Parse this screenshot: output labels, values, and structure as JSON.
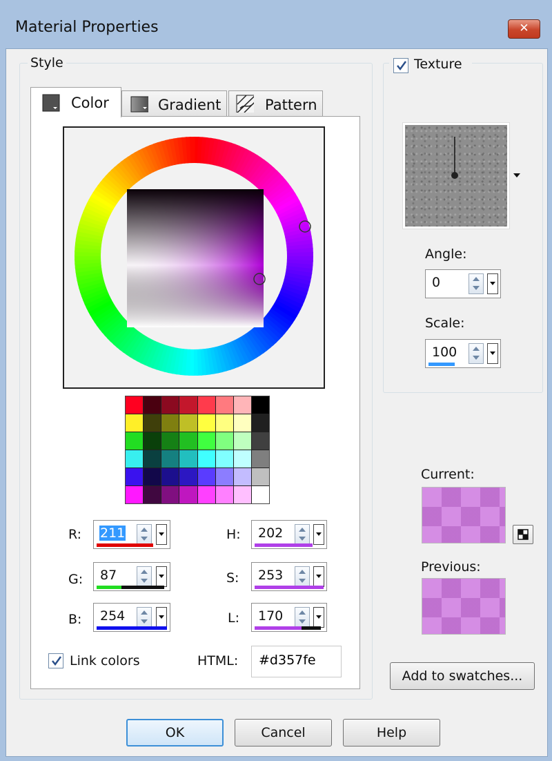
{
  "window": {
    "title": "Material Properties",
    "close_glyph": "✕"
  },
  "style": {
    "legend": "Style",
    "tabs": [
      {
        "label": "Color",
        "icon": "color-swatch-icon"
      },
      {
        "label": "Gradient",
        "icon": "gradient-icon"
      },
      {
        "label": "Pattern",
        "icon": "pattern-icon"
      }
    ],
    "selected_color": "#d357fe",
    "swatch_rows": [
      [
        "#ff0020",
        "#4a0010",
        "#8b0a20",
        "#c3172c",
        "#ff3b4c",
        "#ff7a7f",
        "#ffb5b8",
        "#000000"
      ],
      [
        "#ffef28",
        "#3f3f0a",
        "#7f7f10",
        "#bfbf26",
        "#ffff40",
        "#ffff80",
        "#ffffbf",
        "#202020"
      ],
      [
        "#22dd22",
        "#0a400a",
        "#158015",
        "#22bf22",
        "#40ff40",
        "#80ff80",
        "#bfffbf",
        "#404040"
      ],
      [
        "#38efef",
        "#0a4040",
        "#158080",
        "#22bfbf",
        "#40ffff",
        "#80ffff",
        "#bfffff",
        "#7f7f7f"
      ],
      [
        "#3a12ee",
        "#12084a",
        "#1c0f8d",
        "#2c17c2",
        "#5a3cff",
        "#8c7dff",
        "#c3bcff",
        "#bfbfbf"
      ],
      [
        "#ff18ff",
        "#400840",
        "#800f80",
        "#bf17bf",
        "#ff40ff",
        "#ff80ff",
        "#ffbfff",
        "#ffffff"
      ]
    ],
    "fields": {
      "r": {
        "label": "R:",
        "value": "211",
        "bar_color": "#e00000"
      },
      "g": {
        "label": "G:",
        "value": "87",
        "bar_color": "#22dd22"
      },
      "b": {
        "label": "B:",
        "value": "254",
        "bar_color": "#1010ee"
      },
      "h": {
        "label": "H:",
        "value": "202",
        "bar_color": "#b040e8"
      },
      "s": {
        "label": "S:",
        "value": "253",
        "bar_color": "#b040e8"
      },
      "l": {
        "label": "L:",
        "value": "170",
        "bar_color": "#b040e8"
      }
    },
    "link_colors": {
      "label": "Link colors",
      "checked": true
    },
    "html": {
      "label": "HTML:",
      "value": "#d357fe"
    }
  },
  "texture": {
    "label": "Texture",
    "checked": true,
    "angle": {
      "label": "Angle:",
      "value": "0"
    },
    "scale": {
      "label": "Scale:",
      "value": "100"
    }
  },
  "current": {
    "label": "Current:"
  },
  "previous": {
    "label": "Previous:"
  },
  "buttons": {
    "add_to_swatches": "Add to swatches...",
    "ok": "OK",
    "cancel": "Cancel",
    "help": "Help"
  }
}
